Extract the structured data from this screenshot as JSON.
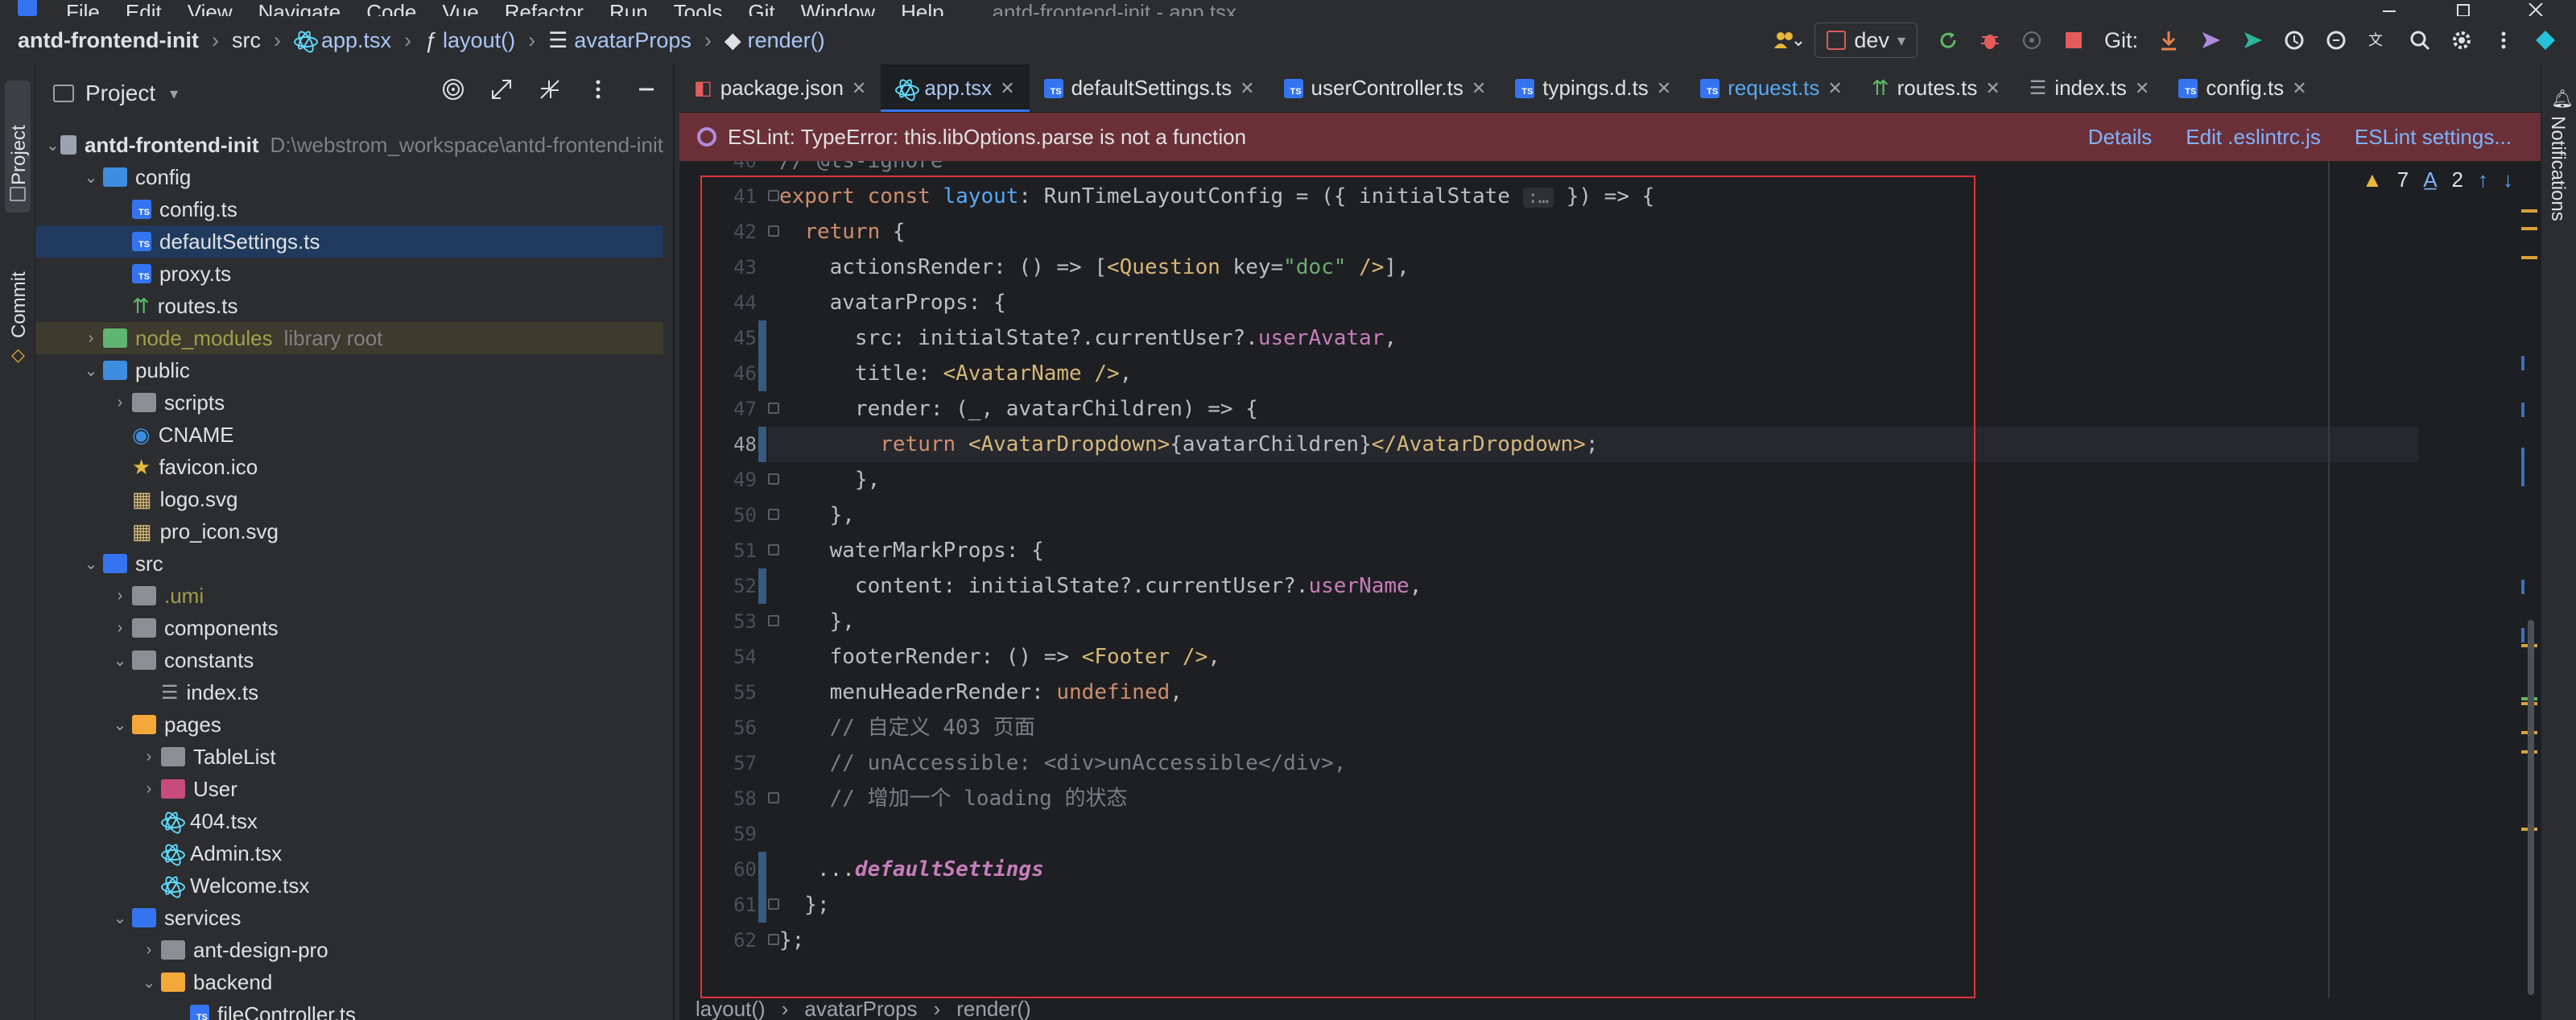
{
  "menubar": {
    "items": [
      "File",
      "Edit",
      "View",
      "Navigate",
      "Code",
      "Vue",
      "Refactor",
      "Run",
      "Tools",
      "Git",
      "Window",
      "Help"
    ],
    "window_title": "antd-frontend-init - app.tsx"
  },
  "navbar": {
    "project": "antd-frontend-init",
    "crumbs": [
      "src",
      "app.tsx",
      "layout()",
      "avatarProps",
      "render()"
    ],
    "run_config": "dev",
    "git_label": "Git:"
  },
  "stripes": {
    "left": [
      "Project",
      "Commit"
    ],
    "right": [
      "Notifications"
    ]
  },
  "project_panel": {
    "title": "Project",
    "tree": [
      {
        "depth": 0,
        "arrow": "v",
        "icon": "folder",
        "name": "antd-frontend-init",
        "hint": "D:\\webstrom_workspace\\antd-frontend-init",
        "bold": true
      },
      {
        "depth": 1,
        "arrow": "v",
        "icon": "folder-blue",
        "name": "config"
      },
      {
        "depth": 2,
        "arrow": "",
        "icon": "ts",
        "name": "config.ts"
      },
      {
        "depth": 2,
        "arrow": "",
        "icon": "ts",
        "name": "defaultSettings.ts",
        "selected": true
      },
      {
        "depth": 2,
        "arrow": "",
        "icon": "ts",
        "name": "proxy.ts"
      },
      {
        "depth": 2,
        "arrow": "",
        "icon": "route",
        "name": "routes.ts"
      },
      {
        "depth": 1,
        "arrow": ">",
        "icon": "folder-green",
        "name": "node_modules",
        "hint": "library root",
        "olive": true,
        "lib": true
      },
      {
        "depth": 1,
        "arrow": "v",
        "icon": "folder-blue",
        "name": "public"
      },
      {
        "depth": 2,
        "arrow": ">",
        "icon": "folder-grey",
        "name": "scripts"
      },
      {
        "depth": 2,
        "arrow": "",
        "icon": "globe",
        "name": "CNAME"
      },
      {
        "depth": 2,
        "arrow": "",
        "icon": "star",
        "name": "favicon.ico"
      },
      {
        "depth": 2,
        "arrow": "",
        "icon": "image",
        "name": "logo.svg"
      },
      {
        "depth": 2,
        "arrow": "",
        "icon": "image",
        "name": "pro_icon.svg"
      },
      {
        "depth": 1,
        "arrow": "v",
        "icon": "folder-navy",
        "name": "src"
      },
      {
        "depth": 2,
        "arrow": ">",
        "icon": "folder-grey",
        "name": ".umi",
        "olive": true
      },
      {
        "depth": 2,
        "arrow": ">",
        "icon": "folder-grey",
        "name": "components"
      },
      {
        "depth": 2,
        "arrow": "v",
        "icon": "folder-grey",
        "name": "constants"
      },
      {
        "depth": 3,
        "arrow": "",
        "icon": "list",
        "name": "index.ts"
      },
      {
        "depth": 2,
        "arrow": "v",
        "icon": "folder-orange",
        "name": "pages"
      },
      {
        "depth": 3,
        "arrow": ">",
        "icon": "folder-grey",
        "name": "TableList"
      },
      {
        "depth": 3,
        "arrow": ">",
        "icon": "folder-pink",
        "name": "User"
      },
      {
        "depth": 3,
        "arrow": "",
        "icon": "react",
        "name": "404.tsx"
      },
      {
        "depth": 3,
        "arrow": "",
        "icon": "react",
        "name": "Admin.tsx"
      },
      {
        "depth": 3,
        "arrow": "",
        "icon": "react",
        "name": "Welcome.tsx"
      },
      {
        "depth": 2,
        "arrow": "v",
        "icon": "folder-navy",
        "name": "services"
      },
      {
        "depth": 3,
        "arrow": ">",
        "icon": "folder-grey",
        "name": "ant-design-pro"
      },
      {
        "depth": 3,
        "arrow": "v",
        "icon": "folder-orange",
        "name": "backend"
      },
      {
        "depth": 4,
        "arrow": "",
        "icon": "ts",
        "name": "fileController.ts"
      }
    ]
  },
  "tabs": [
    {
      "name": "package.json",
      "icon": "json",
      "active": false
    },
    {
      "name": "app.tsx",
      "icon": "react",
      "active": true
    },
    {
      "name": "defaultSettings.ts",
      "icon": "ts",
      "active": false
    },
    {
      "name": "userController.ts",
      "icon": "ts",
      "active": false
    },
    {
      "name": "typings.d.ts",
      "icon": "ts",
      "active": false
    },
    {
      "name": "request.ts",
      "icon": "ts",
      "active": false
    },
    {
      "name": "routes.ts",
      "icon": "route",
      "active": false
    },
    {
      "name": "index.ts",
      "icon": "list",
      "active": false
    },
    {
      "name": "config.ts",
      "icon": "ts",
      "active": false
    }
  ],
  "eslint": {
    "message": "ESLint: TypeError: this.libOptions.parse is not a function",
    "links": [
      "Details",
      "Edit .eslintrc.js",
      "ESLint settings..."
    ]
  },
  "inspections": {
    "warnings": "7",
    "weak": "2"
  },
  "editor": {
    "current_line": 48,
    "lines": [
      {
        "n": 40,
        "tokens": [
          [
            "cm",
            "// @ts-ignore"
          ]
        ]
      },
      {
        "n": 41,
        "tokens": [
          [
            "kw",
            "export const "
          ],
          [
            "fn",
            "layout"
          ],
          [
            "df",
            ": RunTimeLayoutConfig = ({ initialState "
          ],
          [
            "inlay",
            ":…"
          ],
          [
            "df",
            " }) => {"
          ]
        ]
      },
      {
        "n": 42,
        "tokens": [
          [
            "df",
            "  "
          ],
          [
            "kw",
            "return"
          ],
          [
            "df",
            " {"
          ]
        ]
      },
      {
        "n": 43,
        "tokens": [
          [
            "df",
            "    actionsRender: () => ["
          ],
          [
            "tag",
            "<Question "
          ],
          [
            "df",
            "key="
          ],
          [
            "str",
            "\"doc\""
          ],
          [
            "tag",
            " />"
          ],
          [
            "df",
            "],"
          ]
        ]
      },
      {
        "n": 44,
        "tokens": [
          [
            "df",
            "    avatarProps: {"
          ]
        ]
      },
      {
        "n": 45,
        "tokens": [
          [
            "df",
            "      src: initialState?.currentUser?."
          ],
          [
            "pr",
            "userAvatar"
          ],
          [
            "df",
            ","
          ]
        ]
      },
      {
        "n": 46,
        "tokens": [
          [
            "df",
            "      title: "
          ],
          [
            "tag",
            "<AvatarName />"
          ],
          [
            "df",
            ","
          ]
        ]
      },
      {
        "n": 47,
        "tokens": [
          [
            "df",
            "      render: (_, avatarChildren) => {"
          ]
        ]
      },
      {
        "n": 48,
        "tokens": [
          [
            "df",
            "        "
          ],
          [
            "kw",
            "return "
          ],
          [
            "tag",
            "<AvatarDropdown>"
          ],
          [
            "df",
            "{avatarChildren}"
          ],
          [
            "tag",
            "</AvatarDropdown>"
          ],
          [
            "df",
            ";"
          ]
        ]
      },
      {
        "n": 49,
        "tokens": [
          [
            "df",
            "      },"
          ]
        ]
      },
      {
        "n": 50,
        "tokens": [
          [
            "df",
            "    },"
          ]
        ]
      },
      {
        "n": 51,
        "tokens": [
          [
            "df",
            "    waterMarkProps: {"
          ]
        ]
      },
      {
        "n": 52,
        "tokens": [
          [
            "df",
            "      content: initialState?.currentUser?."
          ],
          [
            "pr",
            "userName"
          ],
          [
            "df",
            ","
          ]
        ]
      },
      {
        "n": 53,
        "tokens": [
          [
            "df",
            "    },"
          ]
        ]
      },
      {
        "n": 54,
        "tokens": [
          [
            "df",
            "    footerRender: () => "
          ],
          [
            "tag",
            "<Footer />"
          ],
          [
            "df",
            ","
          ]
        ]
      },
      {
        "n": 55,
        "tokens": [
          [
            "df",
            "    menuHeaderRender: "
          ],
          [
            "kw",
            "undefined"
          ],
          [
            "df",
            ","
          ]
        ]
      },
      {
        "n": 56,
        "tokens": [
          [
            "cm",
            "    // 自定义 403 页面"
          ]
        ]
      },
      {
        "n": 57,
        "tokens": [
          [
            "cm",
            "    // unAccessible: <div>unAccessible</div>,"
          ]
        ]
      },
      {
        "n": 58,
        "tokens": [
          [
            "cm",
            "    // 增加一个 loading 的状态"
          ]
        ]
      },
      {
        "n": 59,
        "tokens": [
          [
            "df",
            ""
          ]
        ]
      },
      {
        "n": 60,
        "tokens": [
          [
            "df",
            "   ..."
          ],
          [
            "it",
            "defaultSettings"
          ]
        ]
      },
      {
        "n": 61,
        "tokens": [
          [
            "df",
            "  };"
          ]
        ]
      },
      {
        "n": 62,
        "tokens": [
          [
            "df",
            "};"
          ]
        ]
      }
    ]
  },
  "breadcrumb": [
    "layout()",
    "avatarProps",
    "render()"
  ]
}
